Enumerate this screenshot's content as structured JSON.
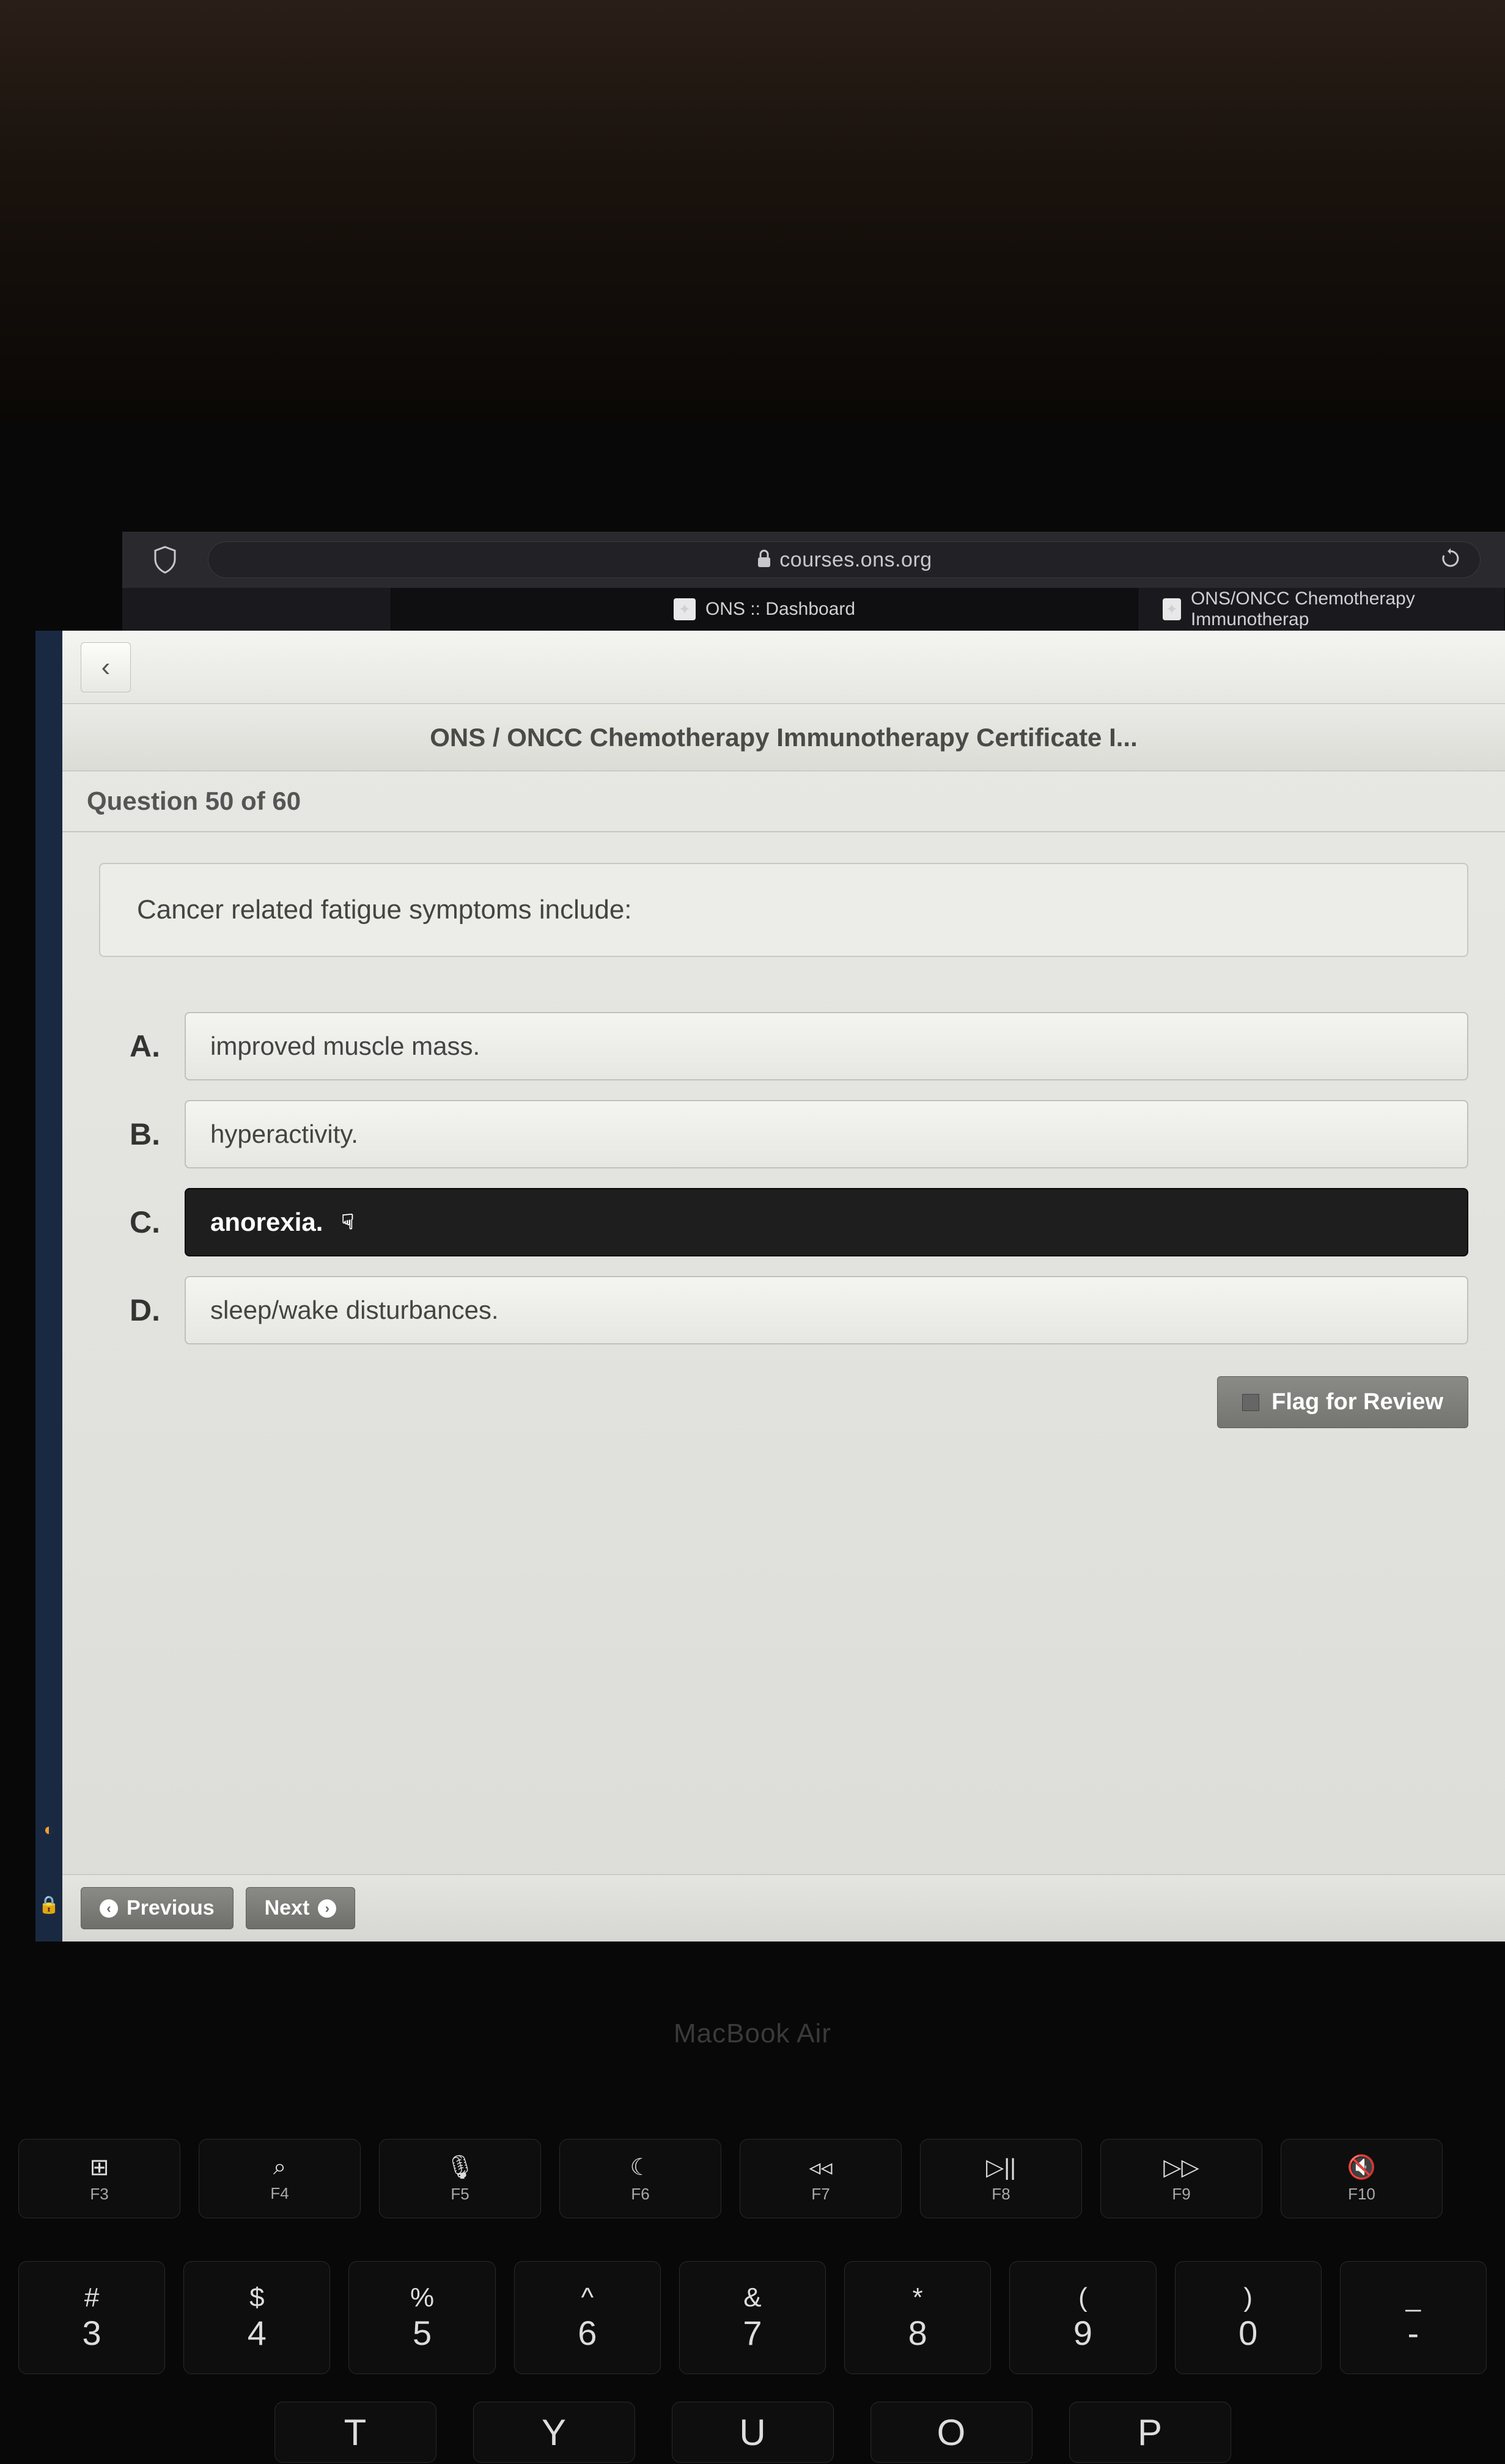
{
  "browser": {
    "url": "courses.ons.org",
    "tabs": {
      "left": "ONS :: Dashboard",
      "right": "ONS/ONCC Chemotherapy Immunotherap"
    }
  },
  "page": {
    "title": "ONS / ONCC Chemotherapy Immunotherapy Certificate I...",
    "question_number": "Question 50 of 60",
    "question_text": "Cancer related fatigue symptoms include:",
    "answers": [
      {
        "letter": "A.",
        "text": "improved muscle mass.",
        "selected": false
      },
      {
        "letter": "B.",
        "text": "hyperactivity.",
        "selected": false
      },
      {
        "letter": "C.",
        "text": "anorexia.",
        "selected": true
      },
      {
        "letter": "D.",
        "text": "sleep/wake disturbances.",
        "selected": false
      }
    ],
    "flag_label": "Flag for Review",
    "previous_label": "Previous",
    "next_label": "Next"
  },
  "laptop": {
    "model": "MacBook Air",
    "fn_keys": [
      {
        "sym": "⊞",
        "label": "F3"
      },
      {
        "sym": "⌕",
        "label": "F4"
      },
      {
        "sym": "🎙",
        "label": "F5"
      },
      {
        "sym": "☾",
        "label": "F6"
      },
      {
        "sym": "◃◃",
        "label": "F7"
      },
      {
        "sym": "▷||",
        "label": "F8"
      },
      {
        "sym": "▷▷",
        "label": "F9"
      },
      {
        "sym": "🔇",
        "label": "F10"
      }
    ],
    "num_keys": [
      {
        "sym": "#",
        "num": "3"
      },
      {
        "sym": "$",
        "num": "4"
      },
      {
        "sym": "%",
        "num": "5"
      },
      {
        "sym": "^",
        "num": "6"
      },
      {
        "sym": "&",
        "num": "7"
      },
      {
        "sym": "*",
        "num": "8"
      },
      {
        "sym": "(",
        "num": "9"
      },
      {
        "sym": ")",
        "num": "0"
      },
      {
        "sym": "_",
        "num": "-"
      }
    ],
    "letter_keys": [
      "T",
      "Y",
      "U",
      "O",
      "P"
    ]
  }
}
